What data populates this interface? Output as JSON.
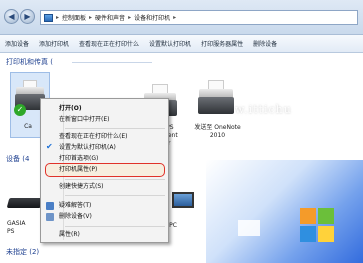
{
  "address_bar": {
    "crumbs": [
      "控制面板",
      "硬件和声音",
      "设备和打印机"
    ],
    "separator": "▸"
  },
  "toolbar": {
    "items": [
      "添加设备",
      "添加打印机",
      "查看现在正在打印什么",
      "设置默认打印机",
      "打印服务器属性",
      "删除设备"
    ]
  },
  "groups": {
    "printers": "打印机和传真 (",
    "devices": "设备 (4",
    "unspecified": "未指定 (2)"
  },
  "devices_printers": [
    {
      "label": "Ca"
    },
    {
      "label": "XPS\nment\nter"
    },
    {
      "label": "发送至 OneNote\n2010"
    }
  ],
  "devices_other": [
    {
      "label": "GASIA\nPS"
    },
    {
      "label": "PC"
    }
  ],
  "context_menu": {
    "items": [
      {
        "label": "打开(O)",
        "bold": true
      },
      {
        "label": "在新窗口中打开(E)"
      },
      {
        "label": "查看现在正在打印什么(E)"
      },
      {
        "label": "设置为默认打印机(A)",
        "checked": true
      },
      {
        "label": "打印首选项(G)"
      },
      {
        "label": "打印机属性(P)",
        "highlighted": true
      },
      {
        "label": "创建快捷方式(S)"
      },
      {
        "label": "疑难解答(T)"
      },
      {
        "label": "删除设备(V)"
      },
      {
        "label": "属性(R)"
      }
    ],
    "highlight_color": "#e0322a"
  },
  "watermark": "w.ittichu"
}
